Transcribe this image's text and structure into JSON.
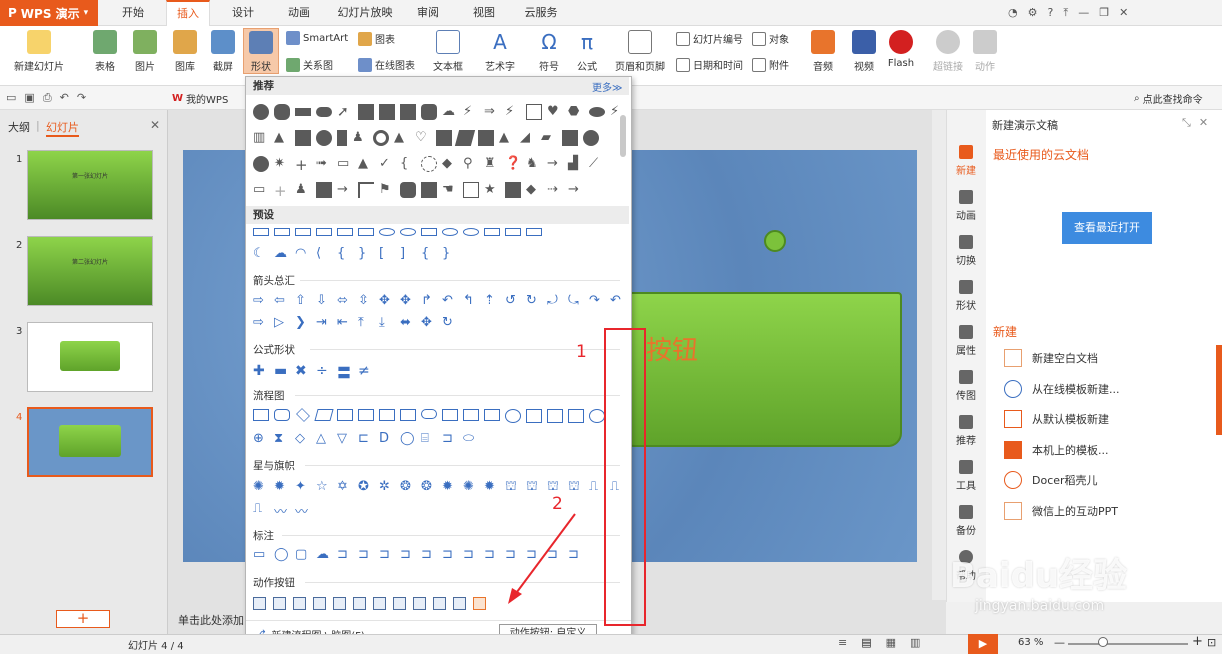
{
  "app": {
    "title": "WPS 演示"
  },
  "tabs": [
    "开始",
    "插入",
    "设计",
    "动画",
    "幻灯片放映",
    "审阅",
    "视图",
    "云服务"
  ],
  "active_tab": "插入",
  "ribbon": {
    "new_slide": "新建幻灯片",
    "table": "表格",
    "picture": "图片",
    "gallery": "图库",
    "screenshot": "截屏",
    "shape": "形状",
    "smartart": "SmartArt",
    "chart": "图表",
    "relation": "关系图",
    "online_chart": "在线图表",
    "textbox": "文本框",
    "wordart": "艺术字",
    "symbol": "符号",
    "formula": "公式",
    "header_footer": "页眉和页脚",
    "slide_number": "幻灯片编号",
    "object": "对象",
    "datetime": "日期和时间",
    "attachment": "附件",
    "audio": "音频",
    "video": "视频",
    "flash": "Flash",
    "hyperlink": "超链接",
    "action": "动作"
  },
  "quickbar": {
    "mywps": "我的WPS",
    "search": "点此查找命令"
  },
  "leftpanel": {
    "tab_outline": "大纲",
    "tab_slides": "幻灯片",
    "slides": [
      {
        "num": "1",
        "text": "第一张幻灯片"
      },
      {
        "num": "2",
        "text": "第二张幻灯片"
      },
      {
        "num": "3",
        "text": ""
      },
      {
        "num": "4",
        "text": ""
      }
    ]
  },
  "slide": {
    "button_text": "按钮",
    "notes_placeholder": "单击此处添加"
  },
  "dropdown": {
    "recommended": "推荐",
    "more": "更多≫",
    "preset": "预设",
    "arrows": "箭头总汇",
    "formula_shapes": "公式形状",
    "flowchart": "流程图",
    "stars": "星与旗帜",
    "callouts": "标注",
    "action_buttons": "动作按钮",
    "footer": "新建流程图 \\ 脑图(F)"
  },
  "tooltip": "动作按钮: 自定义",
  "annotations": {
    "one": "1",
    "two": "2"
  },
  "rightpanel": {
    "title": "新建演示文稿",
    "cloud_recent": "最近使用的云文档",
    "view_recent": "查看最近打开",
    "new_section": "新建",
    "items": [
      "新建空白文档",
      "从在线模板新建...",
      "从默认模板新建",
      "本机上的模板...",
      "Docer稻壳儿",
      "微信上的互动PPT"
    ]
  },
  "rightnav": [
    "新建",
    "动画",
    "切换",
    "形状",
    "属性",
    "传图",
    "推荐",
    "工具",
    "备份",
    "帮助"
  ],
  "statusbar": {
    "slide_pos": "幻灯片 4 / 4",
    "zoom": "63 %"
  },
  "watermark": {
    "text": "Baidu经验",
    "url": "jingyan.baidu.com"
  }
}
